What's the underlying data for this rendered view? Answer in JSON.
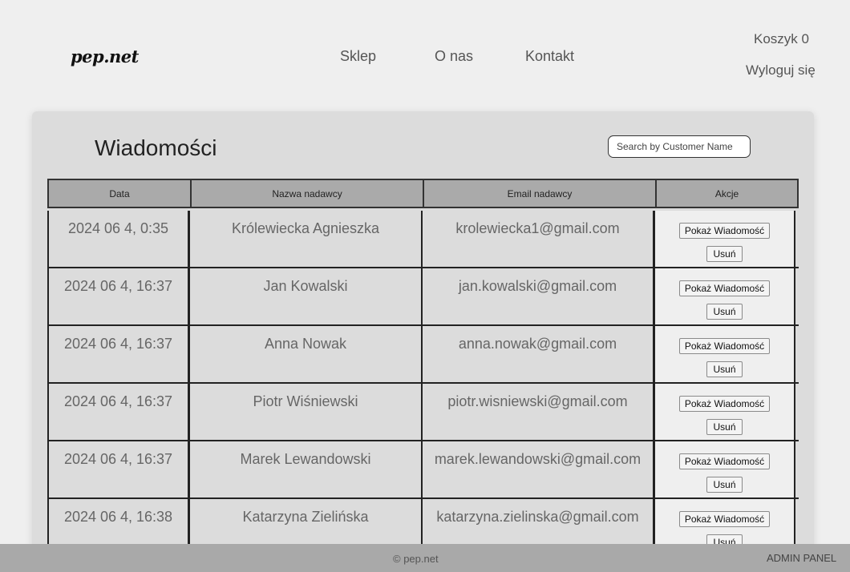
{
  "header": {
    "logo": "pep.net",
    "nav": {
      "shop": "Sklep",
      "about": "O nas",
      "contact": "Kontakt"
    },
    "cart": "Koszyk 0",
    "logout": "Wyloguj się"
  },
  "panel": {
    "title": "Wiadomości",
    "search_placeholder": "Search by Customer Name"
  },
  "table": {
    "headers": {
      "date": "Data",
      "sender": "Nazwa nadawcy",
      "email": "Email nadawcy",
      "actions": "Akcje"
    },
    "show_label": "Pokaż Wiadomość",
    "delete_label": "Usuń",
    "rows": [
      {
        "date": "2024 06 4, 0:35",
        "sender": "Królewiecka Agnieszka",
        "email": "krolewiecka1@gmail.com"
      },
      {
        "date": "2024 06 4, 16:37",
        "sender": "Jan Kowalski",
        "email": "jan.kowalski@gmail.com"
      },
      {
        "date": "2024 06 4, 16:37",
        "sender": "Anna Nowak",
        "email": "anna.nowak@gmail.com"
      },
      {
        "date": "2024 06 4, 16:37",
        "sender": "Piotr Wiśniewski",
        "email": "piotr.wisniewski@gmail.com"
      },
      {
        "date": "2024 06 4, 16:37",
        "sender": "Marek Lewandowski",
        "email": "marek.lewandowski@gmail.com"
      },
      {
        "date": "2024 06 4, 16:38",
        "sender": "Katarzyna Zielińska",
        "email": "katarzyna.zielinska@gmail.com"
      }
    ]
  },
  "footer": {
    "copyright": "© pep.net",
    "admin": "ADMIN PANEL"
  }
}
